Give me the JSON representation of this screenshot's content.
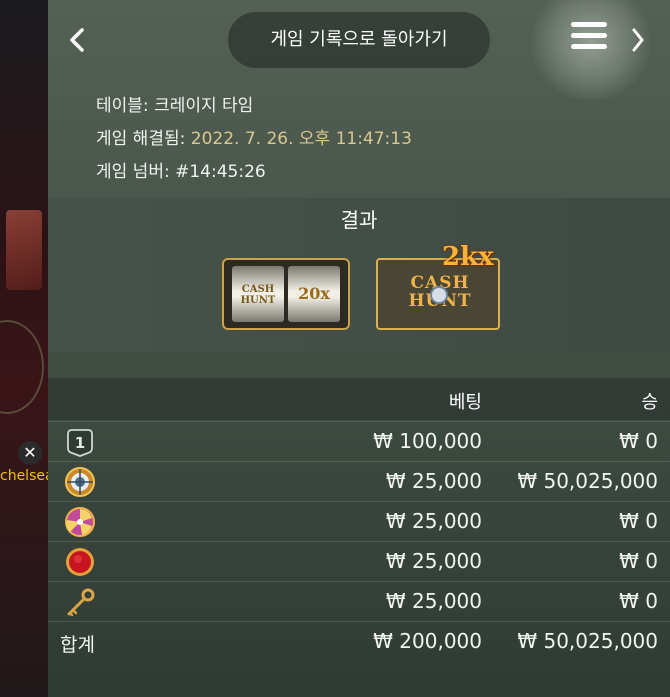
{
  "header": {
    "back_icon": "chevron-left-icon",
    "title": "게임 기록으로 돌아가기",
    "menu_icon": "hamburger-menu-icon",
    "next_icon": "chevron-right-icon"
  },
  "info": {
    "table_label": "테이블: ",
    "table_value": "크레이지 타임",
    "settled_label": "게임 해결됨: ",
    "settled_value": "2022. 7. 26. 오후 11:47:13",
    "game_no_label": "게임 넘버: ",
    "game_no_value": "#14:45:26"
  },
  "results": {
    "title": "결과",
    "top_slot": {
      "left_reel": "CASH HUNT",
      "right_reel": "20x"
    },
    "segment": {
      "name": "CASH HUNT",
      "multiplier": "2kx"
    }
  },
  "table": {
    "col_bet": "베팅",
    "col_win": "승",
    "rows": [
      {
        "icon": "number-1-icon",
        "bet": "₩ 100,000",
        "win": "₩ 0"
      },
      {
        "icon": "cash-hunt-target-icon",
        "bet": "₩ 25,000",
        "win": "₩ 50,025,000"
      },
      {
        "icon": "pachinko-candy-icon",
        "bet": "₩ 25,000",
        "win": "₩ 0"
      },
      {
        "icon": "coin-flip-icon",
        "bet": "₩ 25,000",
        "win": "₩ 0"
      },
      {
        "icon": "crazy-time-key-icon",
        "bet": "₩ 25,000",
        "win": "₩ 0"
      }
    ],
    "total_label": "합계",
    "total_bet": "₩ 200,000",
    "total_win": "₩ 50,025,000"
  },
  "background": {
    "chat_username": "chelsea",
    "close_icon": "close-icon"
  },
  "colors": {
    "accent_gold": "#d9b04d",
    "value_text": "#d8c892",
    "panel_bg": "#4a564b"
  }
}
